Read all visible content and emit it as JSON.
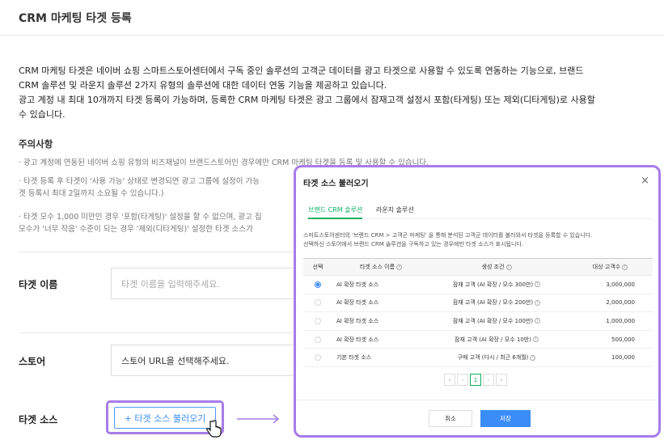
{
  "page": {
    "title": "CRM 마케팅 타겟 등록",
    "desc_lines": [
      "CRM 마케팅 타겟은 네이버 쇼핑 스마트스토어센터에서 구독 중인 솔루션의 고객군 데이터를 광고 타겟으로 사용할 수 있도록 연동하는 기능으로, 브랜드",
      "CRM 솔루션 및 라운지 솔루션 2가지 유형의 솔루션에 대한 데이터 연동 기능을 제공하고 있습니다.",
      "광고 계정 내 최대 10개까지 타겟 등록이 가능하며, 등록한 CRM 마케팅 타겟은 광고 그룹에서 잠재고객 설정시 포함(타게팅) 또는 제외(디타게팅)로 사용할",
      "수 있습니다."
    ],
    "notice_title": "주의사항",
    "notices": [
      "· 광고 계정에 연동된 네이버 쇼핑 유형의 비즈채널이 브랜드스토어인 경우에만 CRM 마케팅 타겟을 등록 및 사용할 수 있습니다.",
      "· 타겟 등록 후 타겟이 '사용 가능' 상태로 변경되면 광고 그룹에 설정이 가능",
      "  겟 등록시 최대 2일까지 소요될 수 있습니다.)",
      "· 타겟 모수 1,000 미만인 경우 '포함(타게팅)' 설정을 할 수 없으며, 광고 집",
      "  모수가 '너무 작음' 수준이 되는 경우 '제외(디타게팅)' 설정한 타겟 소스가"
    ]
  },
  "form": {
    "target_name_label": "타겟 이름",
    "target_name_placeholder": "타겟 이름을 입력해주세요.",
    "store_label": "스토어",
    "store_placeholder": "스토어 URL을 선택해주세요.",
    "source_label": "타겟 소스",
    "load_button": "+ 타겟 소스 불러오기"
  },
  "modal": {
    "title": "타겟 소스 불러오기",
    "close": "×",
    "tabs": [
      "브랜드 CRM 솔루션",
      "라운지 솔루션"
    ],
    "active_tab": 0,
    "desc_lines": [
      "스마트스토어센터의 '브랜드 CRM > 고객군 마케팅' 을 통해 분석된 고객군 데이터를 불러와서 타겟을 등록할 수 있습니다.",
      "선택하신 스토어에서 브랜드 CRM 솔루션을 구독하고 있는 경우에만 타겟 소스가 표시됩니다."
    ],
    "columns": [
      "선택",
      "타겟 소스 이름",
      "생성 조건",
      "대상 고객수"
    ],
    "rows": [
      {
        "name": "AI 확장 타겟 소스",
        "condition": "잠재 고객 (AI 확장 / 모수 300만)",
        "count": "3,000,000",
        "selected": true
      },
      {
        "name": "AI 확장 타겟 소스",
        "condition": "잠재 고객 (AI 확장 / 모수 200만)",
        "count": "2,000,000",
        "selected": false
      },
      {
        "name": "AI 확장 타겟 소스",
        "condition": "잠재 고객 (AI 확장 / 모수 100만)",
        "count": "1,000,000",
        "selected": false
      },
      {
        "name": "AI 확장 타겟 소스",
        "condition": "잠재 고객 (AI 확장 / 모수 10만)",
        "count": "500,000",
        "selected": false
      },
      {
        "name": "기본 타겟 소스",
        "condition": "구매 고객 (다시 / 최근 6개월)",
        "count": "100,000",
        "selected": false
      }
    ],
    "pagination": {
      "first": "«",
      "prev": "‹",
      "current": "1",
      "next": "›",
      "last": "»"
    },
    "cancel": "취소",
    "save": "저장"
  },
  "colors": {
    "accent": "#3a8cf6",
    "highlight": "#a77ce8",
    "tab_active": "#0bb060"
  }
}
